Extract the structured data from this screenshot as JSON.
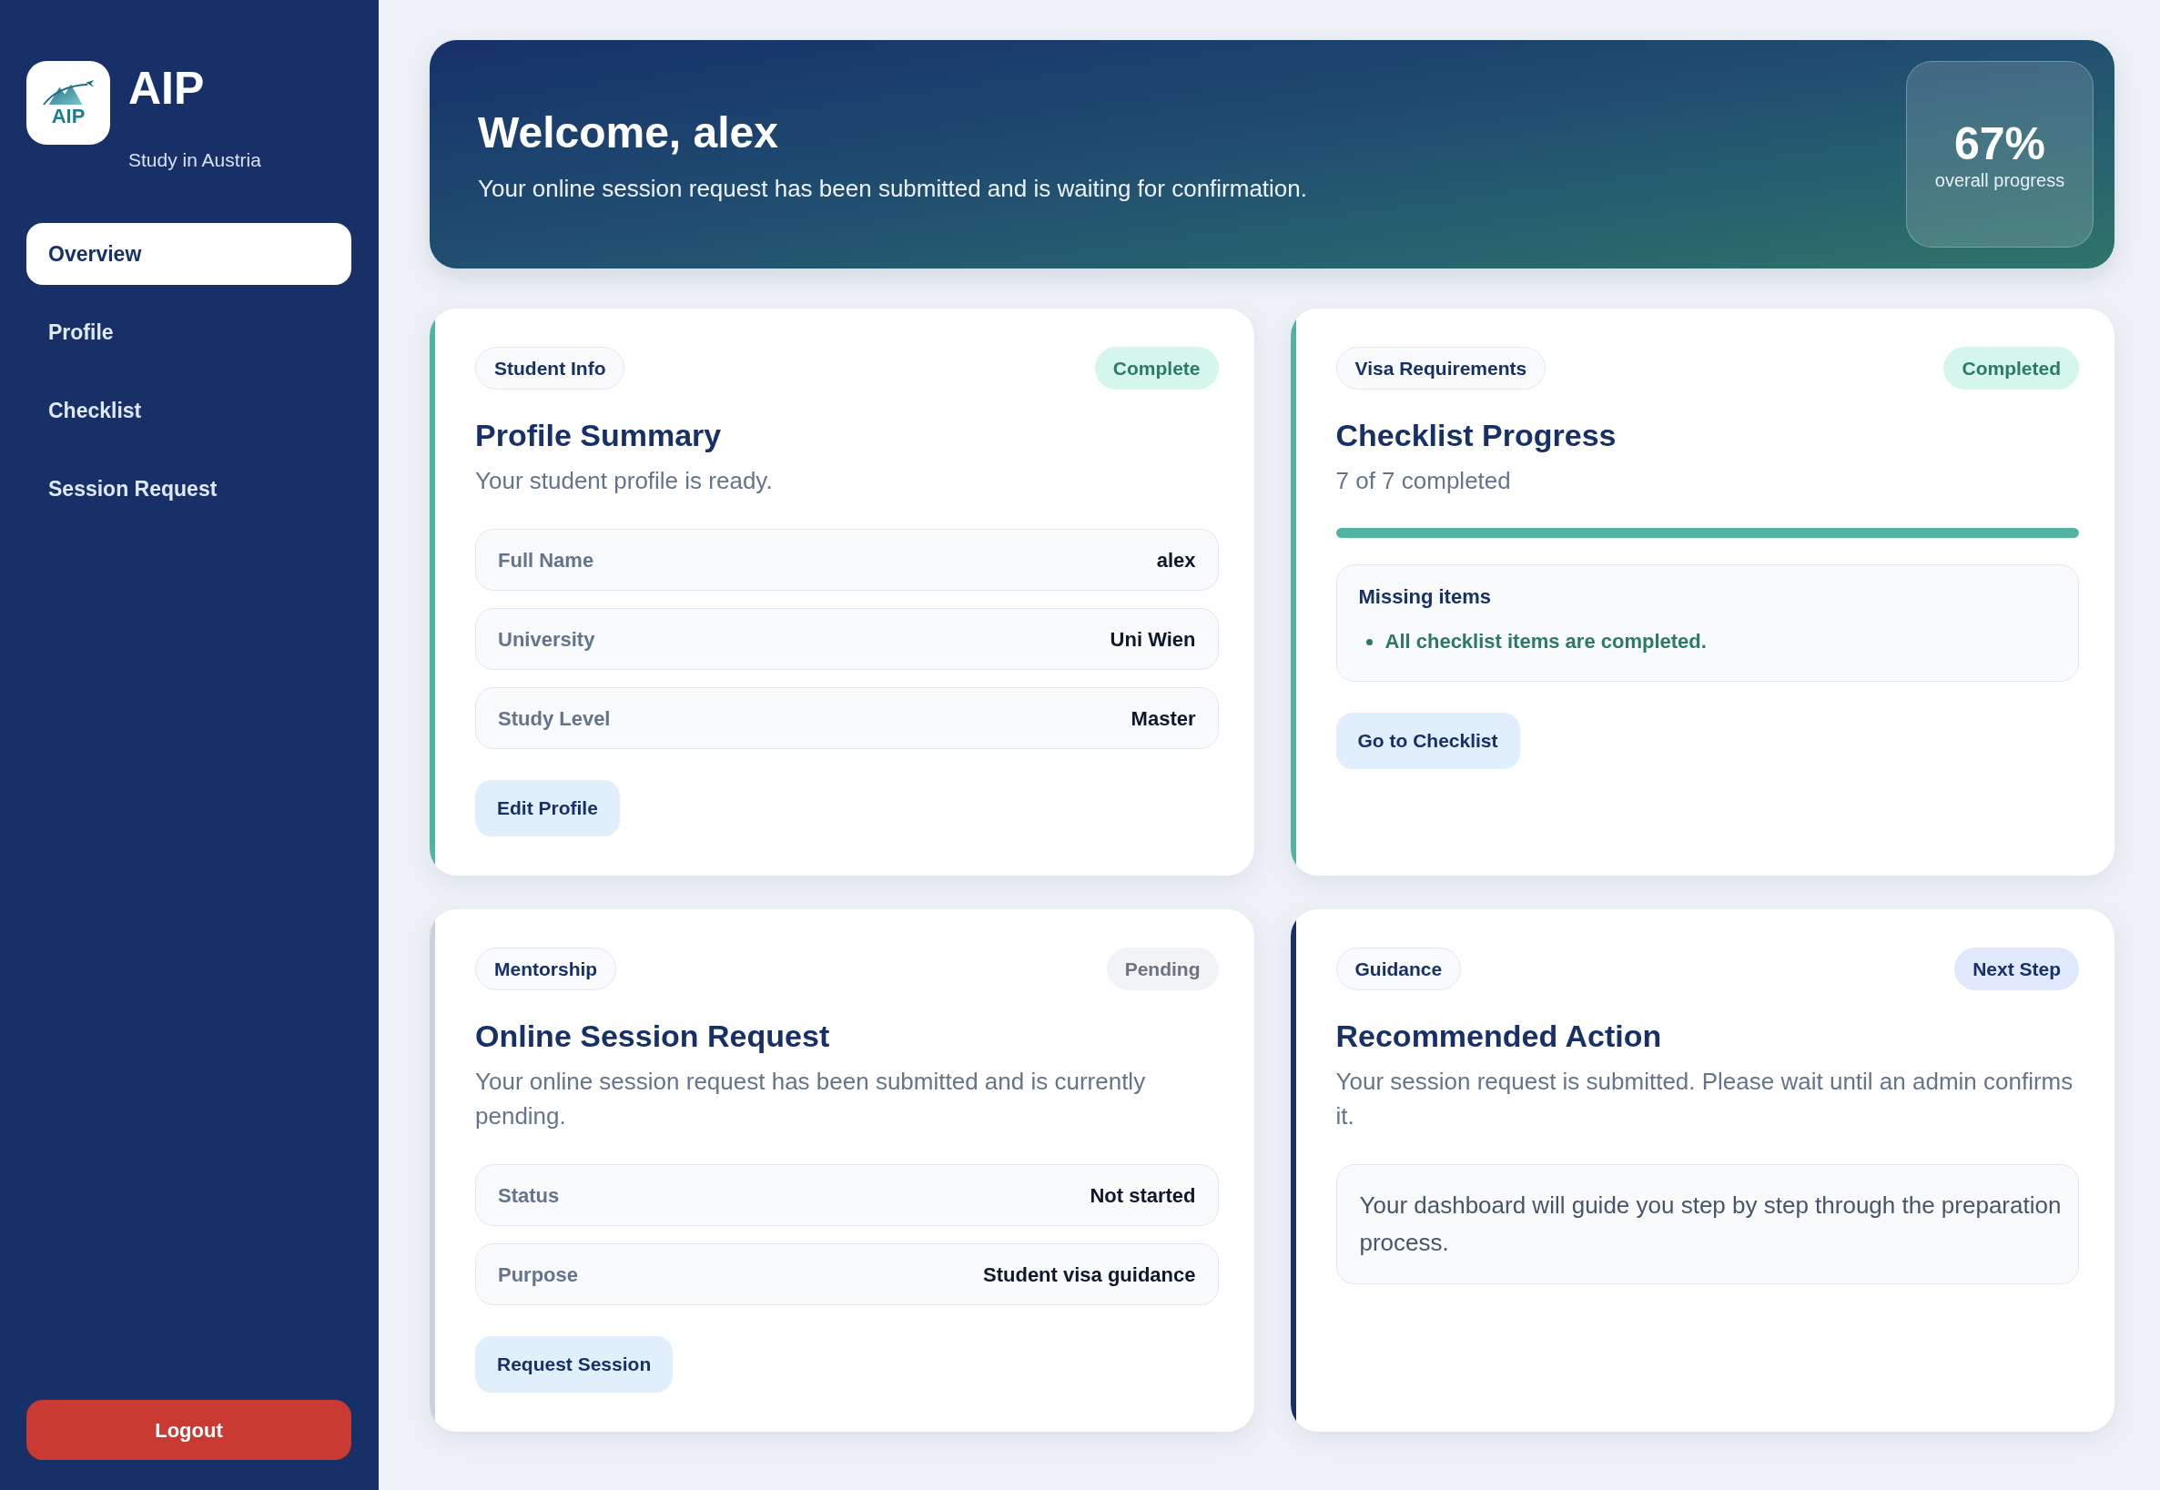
{
  "sidebar": {
    "logo_text": "AIP",
    "title": "AIP",
    "subtitle": "Study in Austria",
    "nav": [
      {
        "label": "Overview",
        "selected": true
      },
      {
        "label": "Profile",
        "selected": false
      },
      {
        "label": "Checklist",
        "selected": false
      },
      {
        "label": "Session Request",
        "selected": false
      }
    ],
    "logout": "Logout"
  },
  "banner": {
    "heading": "Welcome, alex",
    "message": "Your online session request has been submitted and is waiting for confirmation.",
    "progress_value": "67%",
    "progress_label": "overall progress"
  },
  "cards": [
    {
      "kind": "details",
      "color": "#52b3a3",
      "tag": "Student Info",
      "status": {
        "label": "Complete",
        "kind": "success"
      },
      "title": "Profile Summary",
      "description": "Your student profile is ready.",
      "rows": [
        {
          "label": "Full Name",
          "value": "alex"
        },
        {
          "label": "University",
          "value": "Uni Wien"
        },
        {
          "label": "Study Level",
          "value": "Master"
        }
      ],
      "button": "Edit Profile"
    },
    {
      "kind": "progress",
      "color": "#52b3a3",
      "tag": "Visa Requirements",
      "status": {
        "label": "Completed",
        "kind": "success"
      },
      "title": "Checklist Progress",
      "description": "7 of 7 completed",
      "progress": {
        "level": 1
      },
      "missing": {
        "heading": "Missing items",
        "items": [
          "All checklist items are completed."
        ]
      },
      "button": "Go to Checklist"
    },
    {
      "kind": "details",
      "color": "#c9d3e0",
      "tag": "Mentorship",
      "status": {
        "label": "Pending",
        "kind": "neutral"
      },
      "title": "Online Session Request",
      "description": "Your online session request has been submitted and is currently pending.",
      "rows": [
        {
          "label": "Status",
          "value": "Not started"
        },
        {
          "label": "Purpose",
          "value": "Student visa guidance"
        }
      ],
      "button": "Request Session"
    },
    {
      "kind": "note",
      "color": "#173067",
      "tag": "Guidance",
      "status": {
        "label": "Next Step",
        "kind": "info"
      },
      "title": "Recommended Action",
      "description": "Your session request is submitted. Please wait until an admin confirms it.",
      "note": "Your dashboard will guide you step by step through the preparation process."
    }
  ]
}
